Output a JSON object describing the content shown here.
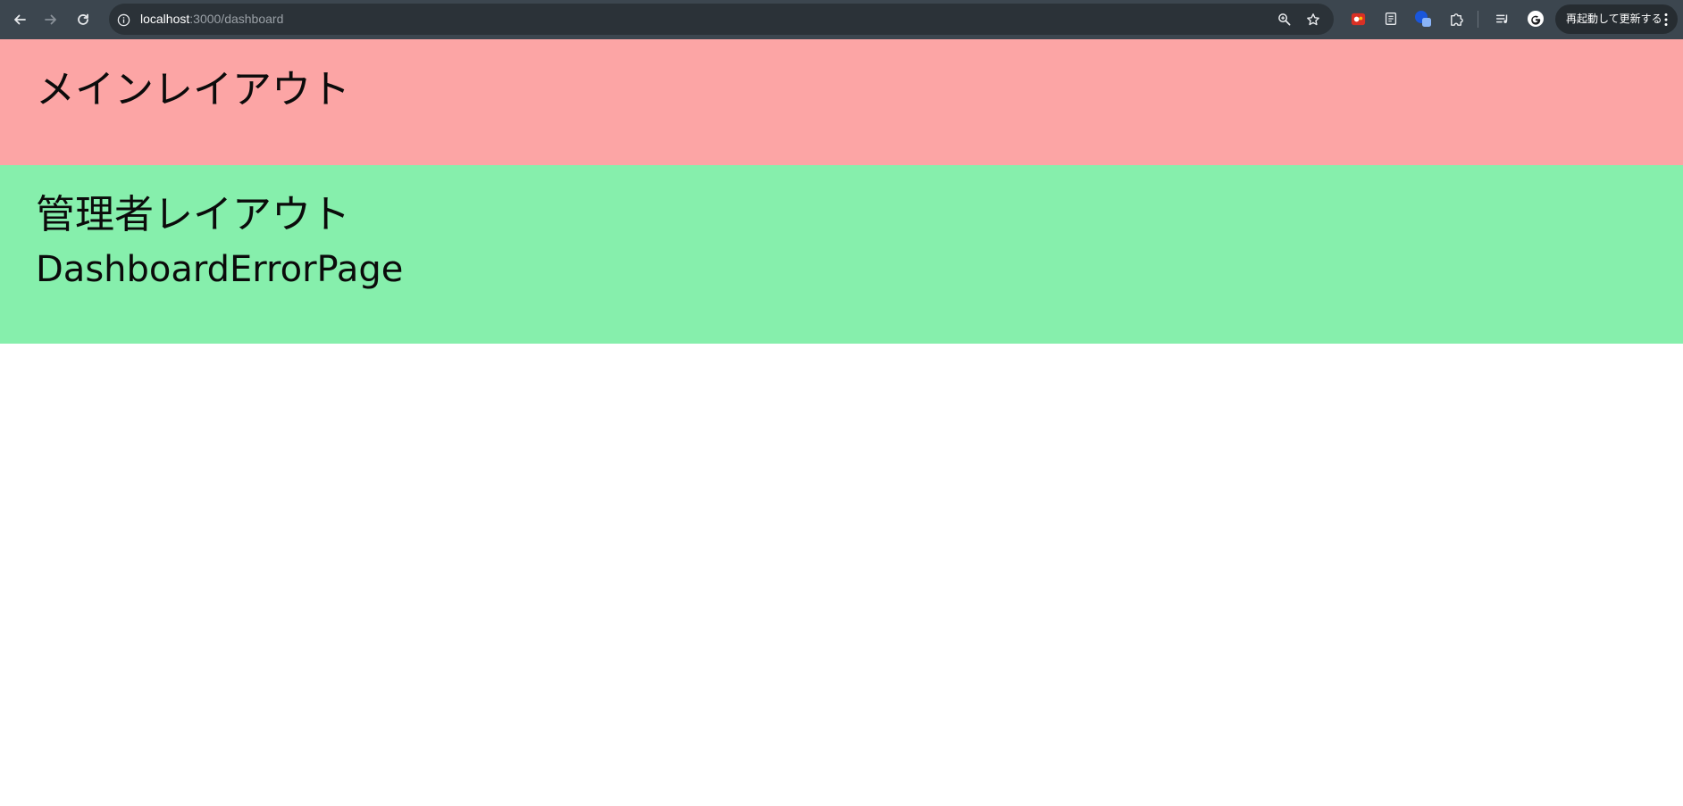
{
  "browser": {
    "url_host": "localhost",
    "url_path": ":3000/dashboard",
    "update_button_label": "再起動して更新する",
    "icons": {
      "back": "arrow-left-icon",
      "forward": "arrow-right-icon",
      "reload": "reload-icon",
      "site_info": "info-icon",
      "zoom": "zoom-icon",
      "bookmark": "star-icon",
      "extensions": [
        "extension-red-icon",
        "extension-doc-icon",
        "extension-blue-icon",
        "puzzle-icon",
        "media-icon",
        "google-account-icon"
      ],
      "menu": "kebab-menu-icon"
    },
    "colors": {
      "toolbar": "#3c464f",
      "omnibox": "#2b3238"
    }
  },
  "page": {
    "main_layout_title": "メインレイアウト",
    "admin_layout_title": "管理者レイアウト",
    "error_page_text": "DashboardErrorPage",
    "colors": {
      "main_layout_bg": "#fca5a5",
      "admin_layout_bg": "#86efac"
    }
  }
}
